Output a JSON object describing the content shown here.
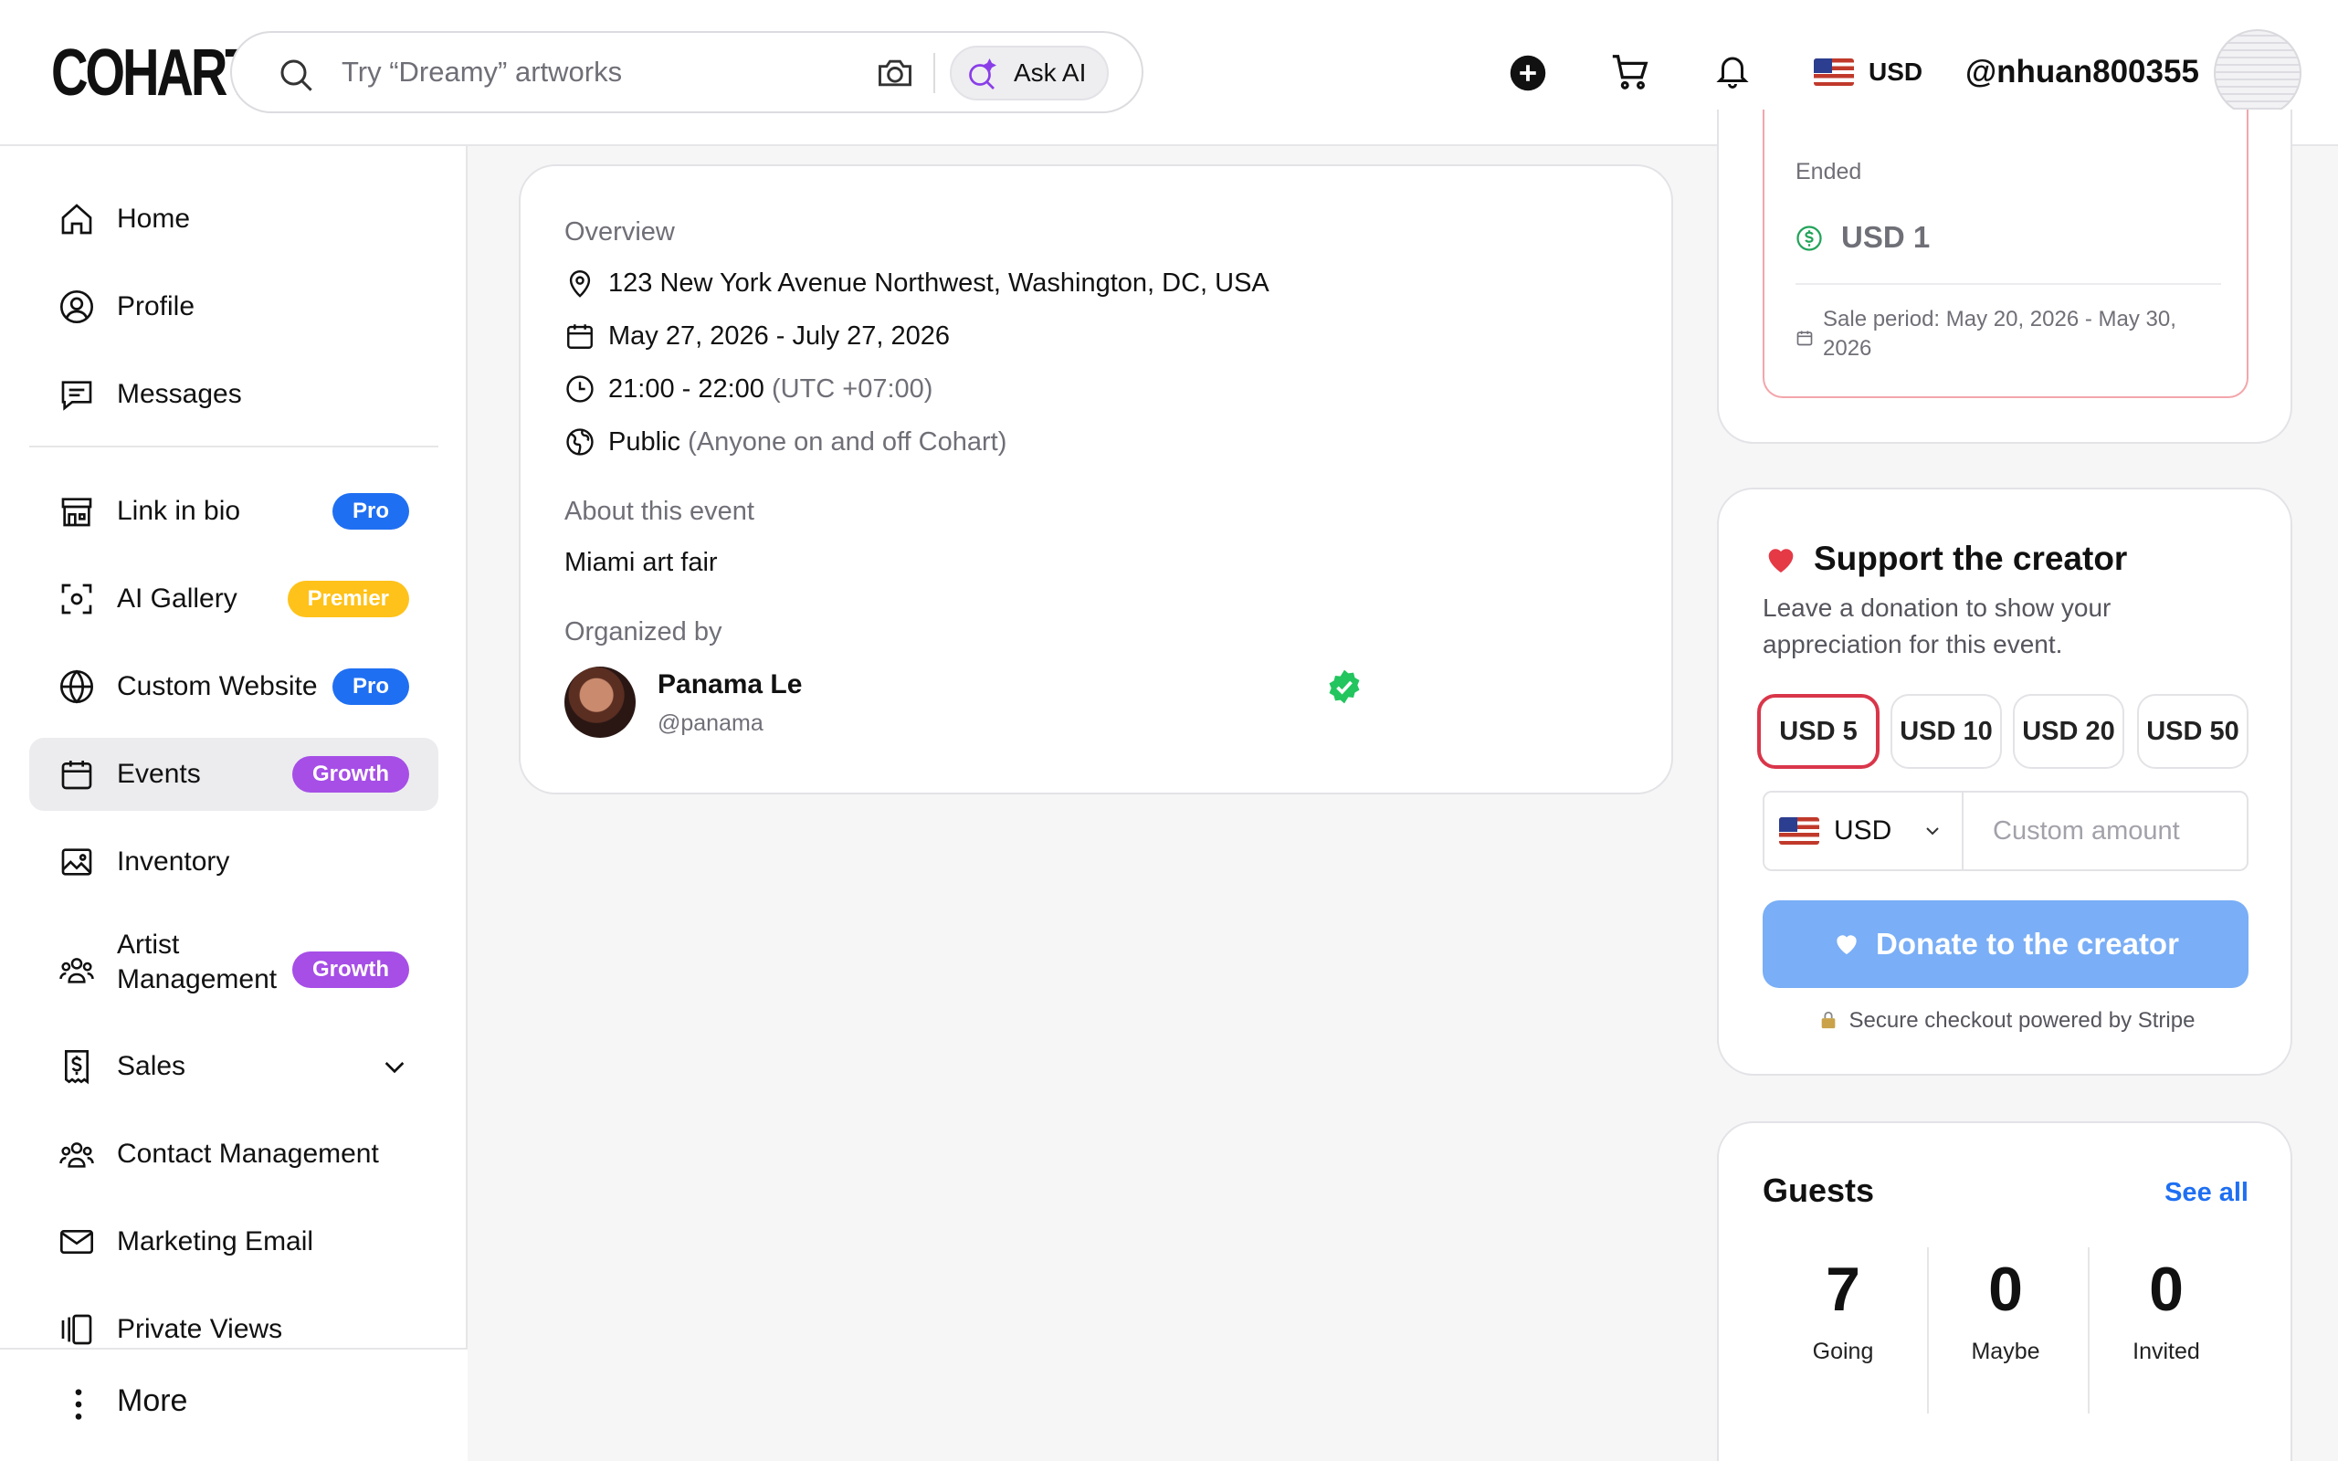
{
  "header": {
    "logo": "COHART",
    "search_placeholder": "Try “Dreamy” artworks",
    "ask_ai_label": "Ask AI",
    "currency": "USD",
    "username": "@nhuan800355"
  },
  "sidebar": {
    "items": [
      {
        "label": "Home"
      },
      {
        "label": "Profile"
      },
      {
        "label": "Messages"
      },
      {
        "label": "Link in bio",
        "badge": "Pro"
      },
      {
        "label": "AI Gallery",
        "badge": "Premier"
      },
      {
        "label": "Custom Website",
        "badge": "Pro"
      },
      {
        "label": "Events",
        "badge": "Growth"
      },
      {
        "label": "Inventory"
      },
      {
        "label": "Artist Management",
        "badge": "Growth"
      },
      {
        "label": "Sales"
      },
      {
        "label": "Contact Management"
      },
      {
        "label": "Marketing Email"
      },
      {
        "label": "Private Views"
      }
    ],
    "more_label": "More"
  },
  "overview": {
    "heading": "Overview",
    "address": "123 New York Avenue Northwest, Washington, DC, USA",
    "dates": "May 27, 2026 - July 27, 2026",
    "time": "21:00 - 22:00",
    "timezone": "(UTC +07:00)",
    "visibility": "Public",
    "visibility_note": "(Anyone on and off Cohart)",
    "about_heading": "About this event",
    "about_text": "Miami art fair",
    "organized_heading": "Organized by",
    "organizer_name": "Panama Le",
    "organizer_handle": "@panama"
  },
  "ticket": {
    "status": "Ended",
    "price": "USD 1",
    "sale_period": "Sale period: May 20, 2026 - May 30, 2026"
  },
  "support": {
    "title": "Support the creator",
    "description": "Leave a donation to show your appreciation for this event.",
    "amounts": [
      "USD 5",
      "USD 10",
      "USD 20",
      "USD 50"
    ],
    "selected_amount": "USD 5",
    "currency": "USD",
    "custom_placeholder": "Custom amount",
    "donate_label": "Donate to the creator",
    "secure_text": "Secure checkout powered by Stripe",
    "colors": {
      "donate_button": "#7aaef6",
      "selected_border": "#d9364a",
      "heart": "#e53946"
    }
  },
  "guests": {
    "title": "Guests",
    "see_all": "See all",
    "stats": [
      {
        "count": "7",
        "label": "Going"
      },
      {
        "count": "0",
        "label": "Maybe"
      },
      {
        "count": "0",
        "label": "Invited"
      }
    ]
  },
  "badge_colors": {
    "Pro": "#1f6ff2",
    "Premier": "#ffc21a",
    "Growth": "#a64ee6"
  }
}
